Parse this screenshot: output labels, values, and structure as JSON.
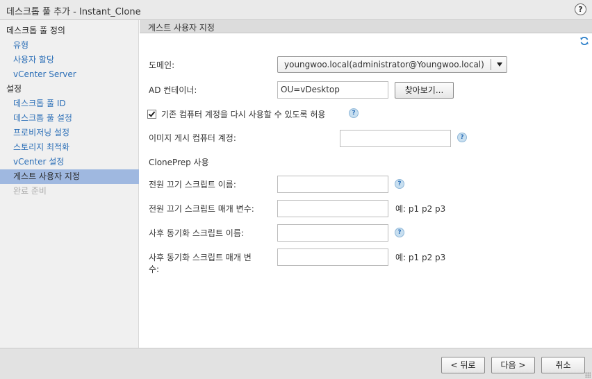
{
  "window": {
    "title": "데스크톱 풀 추가 - Instant_Clone",
    "help_label": "?"
  },
  "sidebar": {
    "items": [
      {
        "label": "데스크톱 풀 정의",
        "kind": "head"
      },
      {
        "label": "유형",
        "kind": "link"
      },
      {
        "label": "사용자 할당",
        "kind": "link"
      },
      {
        "label": "vCenter Server",
        "kind": "link"
      },
      {
        "label": "설정",
        "kind": "head"
      },
      {
        "label": "데스크톱 풀 ID",
        "kind": "link"
      },
      {
        "label": "데스크톱 풀 설정",
        "kind": "link"
      },
      {
        "label": "프로비저닝 설정",
        "kind": "link"
      },
      {
        "label": "스토리지 최적화",
        "kind": "link"
      },
      {
        "label": "vCenter 설정",
        "kind": "link"
      },
      {
        "label": "게스트 사용자 지정",
        "kind": "active"
      },
      {
        "label": "완료 준비",
        "kind": "disabled"
      }
    ]
  },
  "main": {
    "header": "게스트 사용자 지정",
    "domain": {
      "label": "도메인:",
      "value": "youngwoo.local(administrator@Youngwoo.local)"
    },
    "ad_container": {
      "label": "AD 컨테이너:",
      "value": "OU=vDesktop",
      "browse_label": "찾아보기..."
    },
    "reuse_accounts": {
      "label": "기존 컴퓨터 계정을 다시 사용할 수 있도록 허용",
      "checked": true
    },
    "image_publish": {
      "label": "이미지 게시 컴퓨터 계정:",
      "value": ""
    },
    "cloneprep_title": "ClonePrep 사용",
    "poweroff_script": {
      "label": "전원 끄기 스크립트 이름:",
      "value": ""
    },
    "poweroff_params": {
      "label": "전원 끄기 스크립트 매개 변수:",
      "value": "",
      "example": "예: p1 p2 p3"
    },
    "postsync_script": {
      "label": "사후 동기화 스크립트 이름:",
      "value": ""
    },
    "postsync_params": {
      "label_line1": "사후 동기화 스크립트 매개 변",
      "label_line2": "수:",
      "value": "",
      "example": "예: p1 p2 p3"
    },
    "info_glyph": "?"
  },
  "footer": {
    "back_label": "< 뒤로",
    "next_label": "다음 >",
    "cancel_label": "취소"
  }
}
